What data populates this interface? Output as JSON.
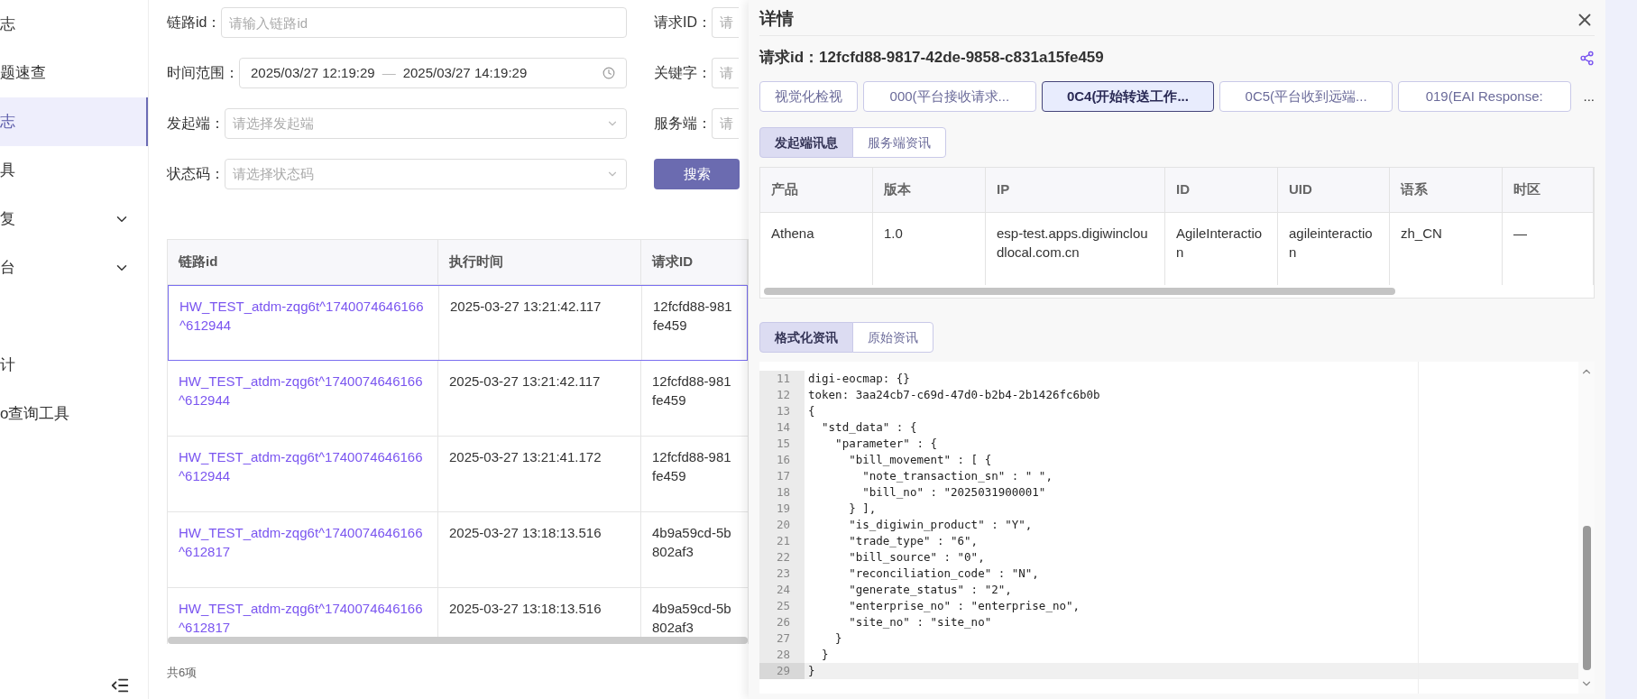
{
  "sidebar": {
    "items": [
      {
        "label": "志",
        "selected": false,
        "expandable": false
      },
      {
        "label": "题速查",
        "selected": false,
        "expandable": false
      },
      {
        "label": "志",
        "selected": true,
        "expandable": false
      },
      {
        "label": "具",
        "selected": false,
        "expandable": false
      },
      {
        "label": "复",
        "selected": false,
        "expandable": true
      },
      {
        "label": "台",
        "selected": false,
        "expandable": true
      }
    ],
    "lower_items": [
      {
        "label": "计",
        "selected": false
      },
      {
        "label": "o查询工具",
        "selected": false
      }
    ]
  },
  "filters": {
    "left": [
      {
        "label": "链路id：",
        "kind": "input",
        "placeholder": "请输入链路id"
      },
      {
        "label": "时间范围：",
        "kind": "range",
        "start": "2025/03/27 12:19:29",
        "separator": "—",
        "end": "2025/03/27 14:19:29"
      },
      {
        "label": "发起端：",
        "kind": "select",
        "placeholder": "请选择发起端"
      },
      {
        "label": "状态码：",
        "kind": "select",
        "placeholder": "请选择状态码"
      }
    ],
    "right": [
      {
        "label": "请求ID：",
        "placeholder": "请"
      },
      {
        "label": "关键字：",
        "placeholder": "请"
      },
      {
        "label": "服务端：",
        "placeholder": "请"
      }
    ],
    "search_button": "搜索"
  },
  "table": {
    "columns": [
      "链路id",
      "执行时间",
      "请求ID"
    ],
    "rows": [
      {
        "trace_id": "HW_TEST_atdm-zqg6t^1740074646166^612944",
        "time": "2025-03-27 13:21:42.117",
        "request_id": [
          "12fcfd88-981",
          "fe459"
        ],
        "selected": true
      },
      {
        "trace_id": "HW_TEST_atdm-zqg6t^1740074646166^612944",
        "time": "2025-03-27 13:21:42.117",
        "request_id": [
          "12fcfd88-981",
          "fe459"
        ],
        "selected": false
      },
      {
        "trace_id": "HW_TEST_atdm-zqg6t^1740074646166^612944",
        "time": "2025-03-27 13:21:41.172",
        "request_id": [
          "12fcfd88-981",
          "fe459"
        ],
        "selected": false
      },
      {
        "trace_id": "HW_TEST_atdm-zqg6t^1740074646166^612817",
        "time": "2025-03-27 13:18:13.516",
        "request_id": [
          "4b9a59cd-5b",
          "802af3"
        ],
        "selected": false
      },
      {
        "trace_id": "HW_TEST_atdm-zqg6t^1740074646166^612817",
        "time": "2025-03-27 13:18:13.516",
        "request_id": [
          "4b9a59cd-5b",
          "802af3"
        ],
        "selected": false
      }
    ],
    "total": "共6项"
  },
  "detail": {
    "title": "详情",
    "request_label": "请求id：",
    "request_id": "12fcfd88-9817-42de-9858-c831a15fe459",
    "steps": [
      {
        "label": "视觉化检视",
        "selected": false
      },
      {
        "label": "000(平台接收请求...",
        "selected": false
      },
      {
        "label": "0C4(开始转送工作...",
        "selected": true
      },
      {
        "label": "0C5(平台收到远端...",
        "selected": false
      },
      {
        "label": "019(EAI Response:",
        "selected": false
      }
    ],
    "more": "...",
    "info_tabs": [
      {
        "label": "发起端讯息",
        "selected": true
      },
      {
        "label": "服务端资讯",
        "selected": false
      }
    ],
    "info_table": {
      "columns": [
        "产品",
        "版本",
        "IP",
        "ID",
        "UID",
        "语系",
        "时区"
      ],
      "rows": [
        [
          "Athena",
          "1.0",
          "esp-test.apps.digiwincloudlocal.com.cn",
          "AgileInteraction",
          "agileinteraction",
          "zh_CN",
          "—"
        ]
      ]
    },
    "format_tabs": [
      {
        "label": "格式化资讯",
        "selected": true
      },
      {
        "label": "原始资讯",
        "selected": false
      }
    ],
    "code": [
      {
        "n": "11",
        "text": "digi-eocmap: {}",
        "current": false
      },
      {
        "n": "12",
        "text": "token: 3aa24cb7-c69d-47d0-b2b4-2b1426fc6b0b",
        "current": false
      },
      {
        "n": "13",
        "text": "{",
        "current": false
      },
      {
        "n": "14",
        "text": "  \"std_data\" : {",
        "current": false
      },
      {
        "n": "15",
        "text": "    \"parameter\" : {",
        "current": false
      },
      {
        "n": "16",
        "text": "      \"bill_movement\" : [ {",
        "current": false
      },
      {
        "n": "17",
        "text": "        \"note_transaction_sn\" : \" \",",
        "current": false
      },
      {
        "n": "18",
        "text": "        \"bill_no\" : \"2025031900001\"",
        "current": false
      },
      {
        "n": "19",
        "text": "      } ],",
        "current": false
      },
      {
        "n": "20",
        "text": "      \"is_digiwin_product\" : \"Y\",",
        "current": false
      },
      {
        "n": "21",
        "text": "      \"trade_type\" : \"6\",",
        "current": false
      },
      {
        "n": "22",
        "text": "      \"bill_source\" : \"0\",",
        "current": false
      },
      {
        "n": "23",
        "text": "      \"reconciliation_code\" : \"N\",",
        "current": false
      },
      {
        "n": "24",
        "text": "      \"generate_status\" : \"2\",",
        "current": false
      },
      {
        "n": "25",
        "text": "      \"enterprise_no\" : \"enterprise_no\",",
        "current": false
      },
      {
        "n": "26",
        "text": "      \"site_no\" : \"site_no\"",
        "current": false
      },
      {
        "n": "27",
        "text": "    }",
        "current": false
      },
      {
        "n": "28",
        "text": "  }",
        "current": false
      },
      {
        "n": "29",
        "text": "}",
        "current": true
      }
    ]
  }
}
